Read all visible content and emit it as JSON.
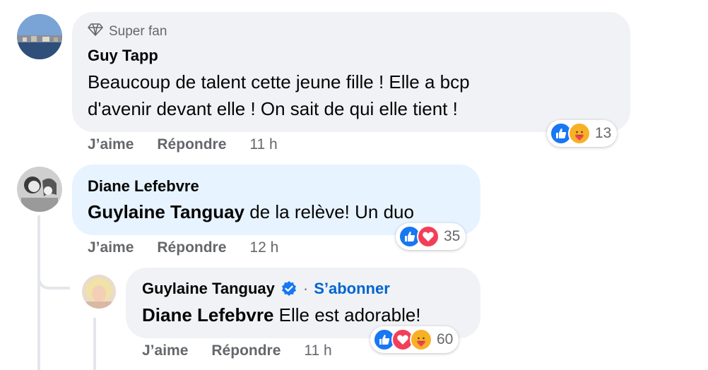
{
  "comments": [
    {
      "badge": "Super fan",
      "author": "Guy Tapp",
      "text_line1": "Beaucoup de talent cette jeune fille ! Elle a bcp",
      "text_line2": "d'avenir devant elle ! On sait de qui elle tient !",
      "like_label": "J’aime",
      "reply_label": "Répondre",
      "time": "11 h",
      "reaction_count": "13",
      "reactions": [
        "like",
        "care"
      ]
    },
    {
      "author": "Diane Lefebvre",
      "mention": "Guylaine Tanguay",
      "text": " de la relève! Un duo",
      "like_label": "J’aime",
      "reply_label": "Répondre",
      "time": "12 h",
      "reaction_count": "35",
      "reactions": [
        "like",
        "love"
      ]
    },
    {
      "author": "Guylaine Tanguay",
      "separator": "·",
      "follow_label": "S’abonner",
      "mention": "Diane Lefebvre",
      "text": " Elle est adorable!",
      "like_label": "J’aime",
      "reply_label": "Répondre",
      "time": "11 h",
      "reaction_count": "60",
      "reactions": [
        "like",
        "love",
        "care"
      ]
    }
  ],
  "colors": {
    "like": "#1877f2",
    "love": "#f33e58",
    "care": "#f7b125",
    "link": "#0064d1",
    "meta": "#65676b"
  }
}
